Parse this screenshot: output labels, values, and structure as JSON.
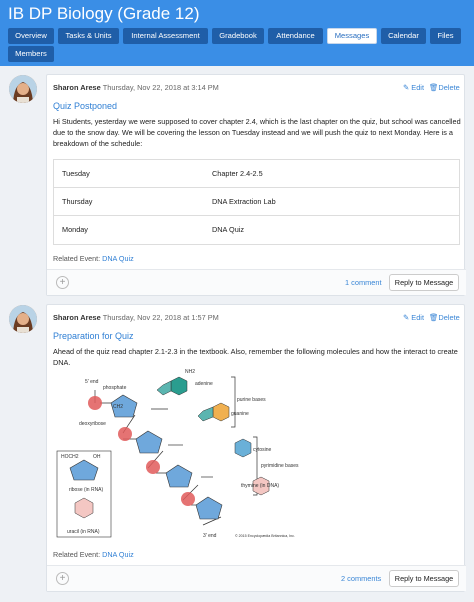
{
  "header": {
    "title": "IB DP Biology (Grade 12)",
    "tabs": [
      {
        "label": "Overview",
        "active": false
      },
      {
        "label": "Tasks & Units",
        "active": false
      },
      {
        "label": "Internal Assessment",
        "active": false
      },
      {
        "label": "Gradebook",
        "active": false
      },
      {
        "label": "Attendance",
        "active": false
      },
      {
        "label": "Messages",
        "active": true
      },
      {
        "label": "Calendar",
        "active": false
      },
      {
        "label": "Files",
        "active": false
      },
      {
        "label": "Members",
        "active": false
      }
    ]
  },
  "posts": [
    {
      "author": "Sharon Arese",
      "timestamp": "Thursday, Nov 22, 2018 at 3:14 PM",
      "edit_label": "Edit",
      "delete_label": "Delete",
      "title": "Quiz Postponed",
      "body": "Hi Students, yesterday we were supposed to cover chapter 2.4, which is the last chapter on the quiz, but school was cancelled due to the snow day. We will be covering the lesson on Tuesday instead and we will push the quiz to next Monday. Here is a breakdown of the schedule:",
      "schedule": [
        {
          "day": "Tuesday",
          "item": "Chapter 2.4-2.5"
        },
        {
          "day": "Thursday",
          "item": "DNA Extraction Lab"
        },
        {
          "day": "Monday",
          "item": "DNA Quiz"
        }
      ],
      "related_label": "Related Event:",
      "related_event": "DNA Quiz",
      "comments": "1 comment",
      "reply_label": "Reply to Message"
    },
    {
      "author": "Sharon Arese",
      "timestamp": "Thursday, Nov 22, 2018 at 1:57 PM",
      "edit_label": "Edit",
      "delete_label": "Delete",
      "title": "Preparation for Quiz",
      "body": "Ahead of the quiz read chapter 2.1-2.3 in the textbook. Also, remember the following molecules and how the interact to create DNA.",
      "related_label": "Related Event:",
      "related_event": "DNA Quiz",
      "comments": "2 comments",
      "reply_label": "Reply to Message"
    }
  ],
  "diagram": {
    "labels": {
      "five_end": "5' end",
      "phosphate": "phosphate",
      "deoxyribose": "deoxyribose",
      "adenine": "adenine",
      "guanine": "guanine",
      "purine": "purine bases",
      "cytosine": "cytosine",
      "pyrimidine": "pyrimidine bases",
      "thymine": "thymine (in DNA)",
      "ribose": "ribose (in RNA)",
      "uracil": "uracil (in RNA)",
      "three_end": "3' end",
      "nh2": "NH2",
      "ch2": "CH2",
      "hoch2": "HOCH2",
      "oh": "OH",
      "copyright": "© 2015 Encyclopædia Britannica, Inc."
    },
    "colors": {
      "phosphate": "#e05a5a",
      "sugar": "#6fa8dc",
      "purine": "#5bb5b0",
      "pyrimidine_c": "#6ab0d8",
      "thymine": "#f4c7c3",
      "adenine": "#2a9d8f",
      "guanine": "#f0b050"
    }
  },
  "colors": {
    "header_bg": "#3a8ee6",
    "tab_bg": "#1f5ea8",
    "link": "#2f7fd4"
  }
}
